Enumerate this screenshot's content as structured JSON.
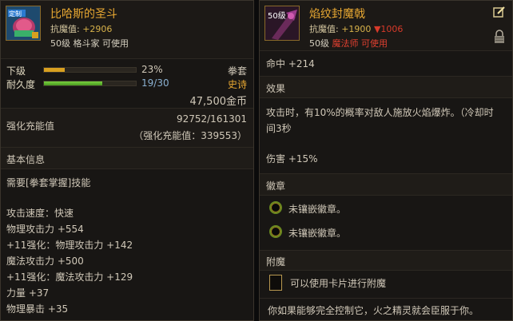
{
  "left": {
    "badge_text": "定制",
    "title": "比哈斯的圣斗",
    "resist_label": "抗魔值:",
    "resist_value": "+2906",
    "req_line": "50级 格斗家 可使用",
    "grade_label": "下级",
    "grade_pct": "23%",
    "grade_fill": 0.23,
    "type": "拳套",
    "durability_label": "耐久度",
    "durability_value": "19/30",
    "durability_fill": 0.633,
    "rarity": "史诗",
    "price": "47,500金币",
    "enhance_label": "强化充能值",
    "enhance_value": "92752/161301",
    "enhance_sub": "（强化充能值：339553）",
    "base_info_label": "基本信息",
    "skill_req": "需要[拳套掌握]技能",
    "attack_speed": "攻击速度：快速",
    "stats": [
      {
        "text": "物理攻击力 +554",
        "color": "white"
      },
      {
        "text": "+11强化：物理攻击力 +142",
        "color": "blue"
      },
      {
        "text": "魔法攻击力 +500",
        "color": "white"
      },
      {
        "text": "+11强化：魔法攻击力 +129",
        "color": "blue"
      },
      {
        "text": "力量 +37",
        "color": "white"
      },
      {
        "text": "物理暴击 +35",
        "color": "white"
      }
    ]
  },
  "right": {
    "badge_text": "50级",
    "title": "焰纹封魔戟",
    "resist_label": "抗魔值:",
    "resist_value": "+1900",
    "resist_down": "▼1006",
    "req_level": "50级",
    "req_class": "魔法师 可使用",
    "hit": "命中 +214",
    "effect_label": "效果",
    "effect_text_line1": "攻击时，有10%的概率对敌人施放火焰爆炸。（冷却时",
    "effect_text_line2": "间3秒",
    "damage": "伤害 +15%",
    "emblem_label": "徽章",
    "emblem_slots": [
      "未镶嵌徽章。",
      "未镶嵌徽章。"
    ],
    "enchant_label": "附魔",
    "enchant_text": "可以使用卡片进行附魔",
    "flavor": "你如果能够完全控制它，火之精灵就会臣服于你。"
  }
}
